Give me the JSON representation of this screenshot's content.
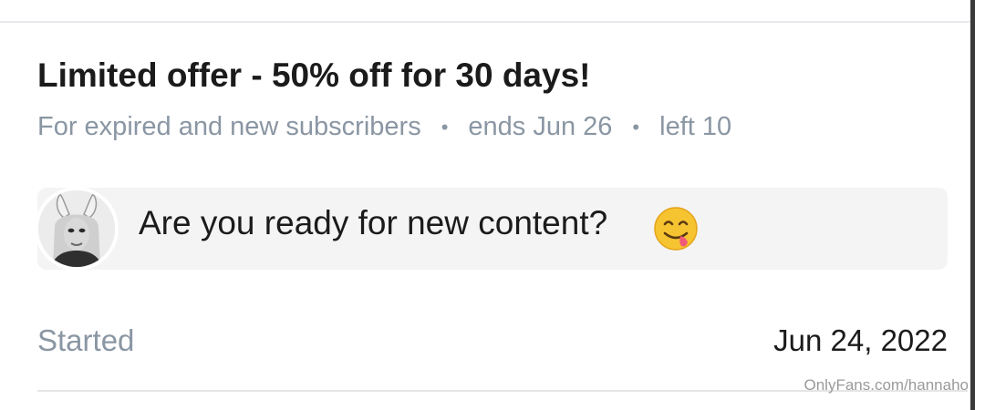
{
  "offer": {
    "title": "Limited offer - 50% off for 30 days!",
    "audience": "For expired and new subscribers",
    "ends": "ends Jun 26",
    "left": "left 10",
    "separator": "•"
  },
  "message": {
    "text": "Are you ready for new content?",
    "emoji_icon": "face-savoring-food-icon"
  },
  "details": {
    "started_label": "Started",
    "started_date": "Jun 24, 2022"
  },
  "watermark": "OnlyFans.com/hannaho",
  "colors": {
    "primary_text": "#1b1b1b",
    "muted_text": "#8a96a3",
    "message_bg": "#f4f4f4",
    "divider": "#e3e5e8"
  }
}
